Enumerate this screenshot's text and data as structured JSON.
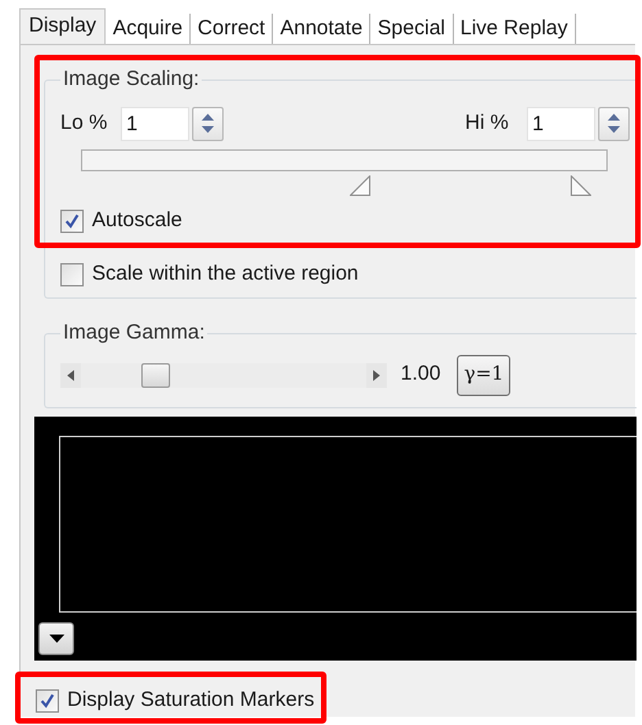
{
  "tabs": [
    {
      "label": "Display",
      "selected": true
    },
    {
      "label": "Acquire",
      "selected": false
    },
    {
      "label": "Correct",
      "selected": false
    },
    {
      "label": "Annotate",
      "selected": false
    },
    {
      "label": "Special",
      "selected": false
    },
    {
      "label": "Live Replay",
      "selected": false
    }
  ],
  "image_scaling": {
    "title": "Image Scaling:",
    "highlighted": true,
    "lo": {
      "label": "Lo %",
      "value": "1"
    },
    "hi": {
      "label": "Hi %",
      "value": "1"
    },
    "markers": [
      {
        "level": 0.55
      },
      {
        "level": 0.93
      }
    ],
    "autoscale": {
      "label": "Autoscale",
      "checked": true
    },
    "scale_within_active_region": {
      "label": "Scale within the active region",
      "checked": false
    }
  },
  "image_gamma": {
    "title": "Image Gamma:",
    "level": 0.23,
    "reading": "1.00",
    "reset_button": "γ=1"
  },
  "saturation_markers": {
    "label": "Display Saturation Markers",
    "checked": true,
    "highlighted": true
  }
}
